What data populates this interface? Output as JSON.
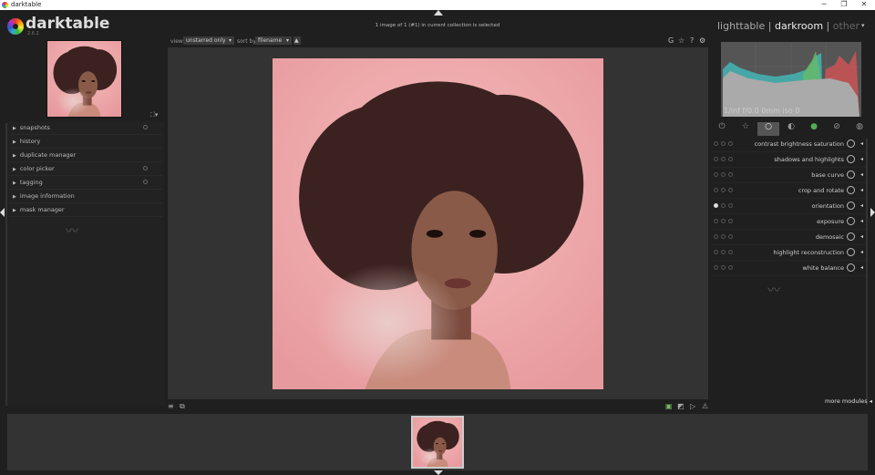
{
  "window": {
    "title": "darktable",
    "min": "─",
    "max": "❐",
    "close": "✕"
  },
  "brand": {
    "name": "darktable",
    "version": "2.6.2"
  },
  "top_toolbar": {
    "view_label": "view",
    "view_value": "unstarred only",
    "sort_label": "sort by",
    "sort_value": "filename",
    "icons": [
      "G",
      "☆",
      "?",
      "⚙"
    ]
  },
  "status_message": "1 image of 1 (#1) in current collection is selected",
  "views": {
    "lighttable": "lighttable",
    "sep": "|",
    "darkroom": "darkroom",
    "other": "other",
    "active": "darkroom"
  },
  "histogram": {
    "info": "1/inf f/0.0 0mm iso 0"
  },
  "left_panel": {
    "items": [
      {
        "label": "snapshots",
        "dot": true
      },
      {
        "label": "history",
        "dot": false
      },
      {
        "label": "duplicate manager",
        "dot": false
      },
      {
        "label": "color picker",
        "dot": true
      },
      {
        "label": "tagging",
        "dot": true
      },
      {
        "label": "image information",
        "dot": false
      },
      {
        "label": "mask manager",
        "dot": false
      }
    ]
  },
  "module_groups": [
    "power-icon",
    "star-icon",
    "circle-icon",
    "tone-icon",
    "color-icon",
    "correct-icon",
    "effect-icon"
  ],
  "modules": [
    {
      "label": "contrast brightness saturation",
      "enabled": false
    },
    {
      "label": "shadows and highlights",
      "enabled": false
    },
    {
      "label": "base curve",
      "enabled": false
    },
    {
      "label": "crop and rotate",
      "enabled": false
    },
    {
      "label": "orientation",
      "enabled": true
    },
    {
      "label": "exposure",
      "enabled": false
    },
    {
      "label": "demosaic",
      "enabled": false
    },
    {
      "label": "highlight reconstruction",
      "enabled": false
    },
    {
      "label": "white balance",
      "enabled": false
    }
  ],
  "more_modules": "more modules",
  "colors": {
    "accent_bg": "#333333",
    "photo_bg": "#f0aeb0",
    "hair": "#3b2220",
    "skin": "#8a5a48"
  }
}
